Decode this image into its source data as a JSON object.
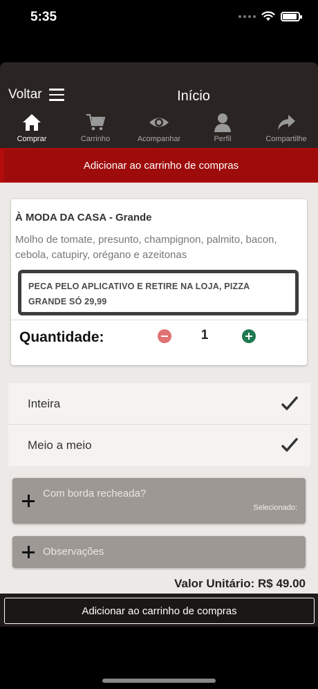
{
  "status_bar": {
    "time": "5:35"
  },
  "header": {
    "back_label": "Voltar",
    "title": "Início",
    "tabs": [
      {
        "label": "Comprar",
        "icon": "home-icon",
        "active": true
      },
      {
        "label": "Carrinho",
        "icon": "cart-icon",
        "active": false
      },
      {
        "label": "Acompanhar",
        "icon": "eye-icon",
        "active": false
      },
      {
        "label": "Perfil",
        "icon": "person-icon",
        "active": false
      },
      {
        "label": "Compartilhe",
        "icon": "share-icon",
        "active": false
      }
    ]
  },
  "banner": {
    "text": "Adicionar ao carrinho de compras"
  },
  "product": {
    "title": "À MODA DA CASA - Grande",
    "description": "Molho de tomate, presunto, champignon, palmito, bacon, cebola, catupiry, orégano e azeitonas",
    "promo": "PECA PELO APLICATIVO E RETIRE NA LOJA, PIZZA GRANDE SÓ 29,99",
    "quantity_label": "Quantidade:",
    "quantity": "1"
  },
  "options": [
    {
      "label": "Inteira"
    },
    {
      "label": "Meio a meio"
    }
  ],
  "extras": {
    "borda_label": "Com borda recheada?",
    "selected_label": "Selecionado:",
    "obs_label": "Observações"
  },
  "unit_value": "Valor Unitário: R$ 49.00",
  "bottom_button": "Adicionar ao carrinho de compras",
  "colors": {
    "navbar": "#2a2422",
    "banner": "#9e0b0b",
    "minus": "#e07272",
    "plus": "#1f7a52",
    "panel": "#9d9894"
  }
}
